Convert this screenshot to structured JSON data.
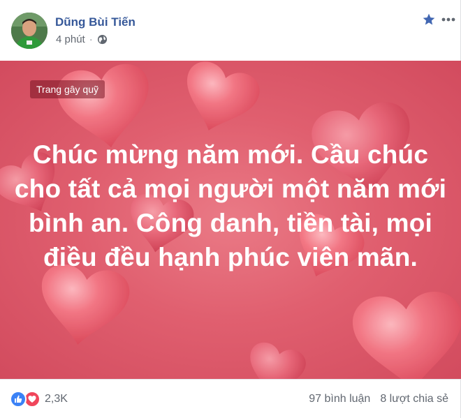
{
  "post": {
    "author": "Dũng Bùi Tiến",
    "time": "4 phút",
    "separator": "·",
    "privacy_icon": "globe-icon",
    "favorite_icon": "star-icon",
    "menu_icon": "more-options-icon"
  },
  "banner": {
    "tag_label": "Trang gây quỹ",
    "message": "Chúc mừng năm mới. Cầu chúc cho tất cả mọi người một năm mới bình an. Công danh, tiền tài, mọi điều đều hạnh phúc viên mãn.",
    "background_color": "#e05f6f",
    "decoration": "hearts"
  },
  "footer": {
    "reaction_icons": [
      "like-icon",
      "love-icon"
    ],
    "reaction_count": "2,3K",
    "comments": "97 bình luận",
    "shares": "8 lượt chia sẻ"
  },
  "colors": {
    "author_link": "#365899",
    "meta_text": "#616770",
    "like_blue": "#3b82f6",
    "love_red": "#f0465b"
  }
}
